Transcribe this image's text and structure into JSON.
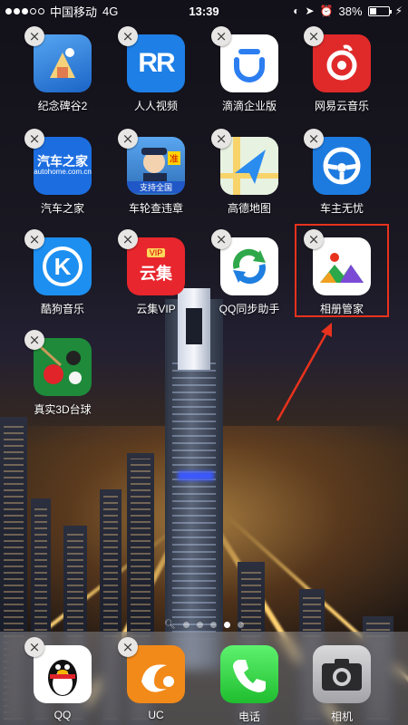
{
  "status_bar": {
    "carrier": "中国移动",
    "network": "4G",
    "time": "13:39",
    "battery_percent": "38%",
    "battery_level": 0.38,
    "signal_bars_filled": 3,
    "signal_bars_total": 5
  },
  "apps": [
    {
      "label": "纪念碑谷2",
      "icon": "monument-valley-icon"
    },
    {
      "label": "人人视频",
      "icon": "renren-video-icon",
      "icon_text": "RR"
    },
    {
      "label": "滴滴企业版",
      "icon": "didi-icon"
    },
    {
      "label": "网易云音乐",
      "icon": "netease-music-icon"
    },
    {
      "label": "汽车之家",
      "icon": "autohome-icon",
      "icon_text": "汽车之家",
      "icon_subtext": "autohome.com.cn"
    },
    {
      "label": "车轮查违章",
      "icon": "traffic-violation-icon",
      "icon_badge_text": "准",
      "icon_banner": "支持全国"
    },
    {
      "label": "高德地图",
      "icon": "amap-icon"
    },
    {
      "label": "车主无忧",
      "icon": "steering-wheel-icon"
    },
    {
      "label": "酷狗音乐",
      "icon": "kugou-icon",
      "icon_text": "K"
    },
    {
      "label": "云集VIP",
      "icon": "yunji-icon",
      "icon_text": "云集",
      "icon_subtext": "VIP"
    },
    {
      "label": "QQ同步助手",
      "icon": "qq-sync-icon"
    },
    {
      "label": "相册管家",
      "icon": "album-manager-icon"
    },
    {
      "label": "真实3D台球",
      "icon": "snooker-icon"
    }
  ],
  "dock": [
    {
      "label": "QQ",
      "icon": "qq-penguin-icon"
    },
    {
      "label": "UC",
      "icon": "uc-browser-icon"
    },
    {
      "label": "电话",
      "icon": "phone-icon"
    },
    {
      "label": "相机",
      "icon": "camera-icon"
    }
  ],
  "pager": {
    "pages": 5,
    "active_index": 3
  },
  "colors": {
    "highlight": "#e8321d",
    "delete_badge": "#e7e6e4"
  }
}
